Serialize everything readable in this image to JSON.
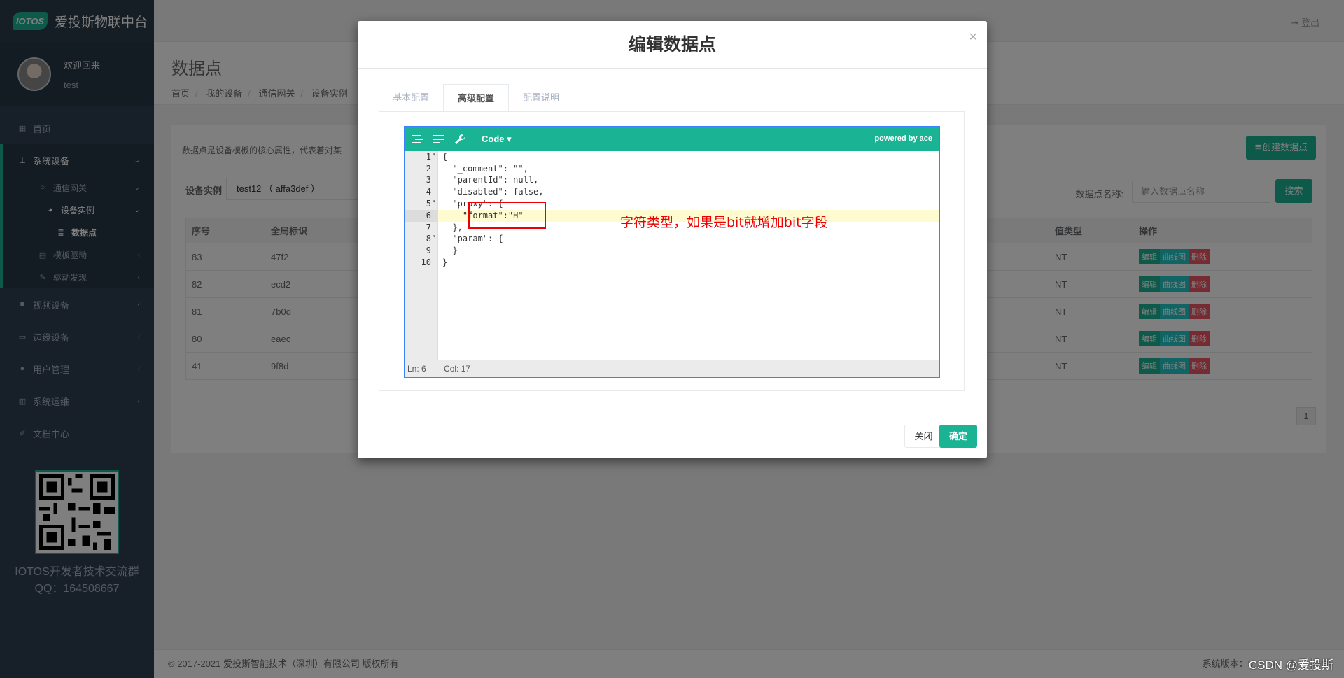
{
  "brand": {
    "logo_text": "IOTOS",
    "name": "爱投斯物联中台"
  },
  "profile": {
    "welcome": "欢迎回来",
    "username": "test"
  },
  "sidebar": {
    "items": [
      {
        "label": "首页",
        "icon": "grid-icon"
      },
      {
        "label": "系统设备",
        "icon": "sitemap-icon"
      },
      {
        "label": "通信网关",
        "icon": "circle-icon"
      },
      {
        "label": "设备实例",
        "icon": "dashboard-icon"
      },
      {
        "label": "数据点",
        "icon": "database-icon"
      },
      {
        "label": "模板驱动",
        "icon": "book-icon"
      },
      {
        "label": "驱动发现",
        "icon": "magic-icon"
      },
      {
        "label": "视频设备",
        "icon": "video-icon"
      },
      {
        "label": "边缘设备",
        "icon": "laptop-icon"
      },
      {
        "label": "用户管理",
        "icon": "user-icon"
      },
      {
        "label": "系统运维",
        "icon": "bar-chart-icon"
      },
      {
        "label": "文档中心",
        "icon": "edit-icon"
      }
    ]
  },
  "qr": {
    "line1": "IOTOS开发者技术交流群",
    "line2": "QQ：164508667"
  },
  "topbar": {
    "logout": "登出"
  },
  "page": {
    "title": "数据点",
    "breadcrumb": [
      "首页",
      "我的设备",
      "通信网关",
      "设备实例"
    ],
    "description": "数据点是设备模板的核心属性，代表着对某",
    "create_button": "创建数据点",
    "device_label": "设备实例",
    "device_value": "test12 （ affa3def ）",
    "search_label": "数据点名称:",
    "search_placeholder": "输入数据点名称",
    "search_button": "搜索"
  },
  "table": {
    "headers": [
      "序号",
      "全局标识",
      "",
      "值类型",
      "操作"
    ],
    "rows": [
      {
        "id": "83",
        "gid": "47f2",
        "vtype": "NT"
      },
      {
        "id": "82",
        "gid": "ecd2",
        "vtype": "NT"
      },
      {
        "id": "81",
        "gid": "7b0d",
        "vtype": "NT"
      },
      {
        "id": "80",
        "gid": "eaec",
        "vtype": "NT"
      },
      {
        "id": "41",
        "gid": "9f8d",
        "vtype": "NT"
      }
    ],
    "ops": {
      "edit": "编辑",
      "curve": "曲线图",
      "delete": "删除"
    }
  },
  "pager": {
    "page": "1"
  },
  "footer": {
    "copyright": "© 2017-2021 爱投斯智能技术（深圳）有限公司 版权所有",
    "version": "系统版本：5"
  },
  "watermark": "CSDN @爱投斯",
  "modal": {
    "title": "编辑数据点",
    "close_icon": "×",
    "tabs": [
      "基本配置",
      "高级配置",
      "配置说明"
    ],
    "active_tab": 1,
    "editor": {
      "mode": "Code",
      "powered": "powered by ace",
      "lines": [
        "{",
        "  \"_comment\": \"\",",
        "  \"parentId\": null,",
        "  \"disabled\": false,",
        "  \"proxy\": {",
        "    \"format\":\"H\"",
        "  },",
        "  \"param\": {",
        "  }",
        "}"
      ],
      "status_ln": "Ln: 6",
      "status_col": "Col: 17",
      "annotation": "字符类型，如果是bit就增加bit字段"
    },
    "close_button": "关闭",
    "ok_button": "确定"
  },
  "colors": {
    "accent": "#1ab394",
    "sidebar": "#2f4050",
    "danger": "#ed5565",
    "annotation": "#e00000"
  }
}
